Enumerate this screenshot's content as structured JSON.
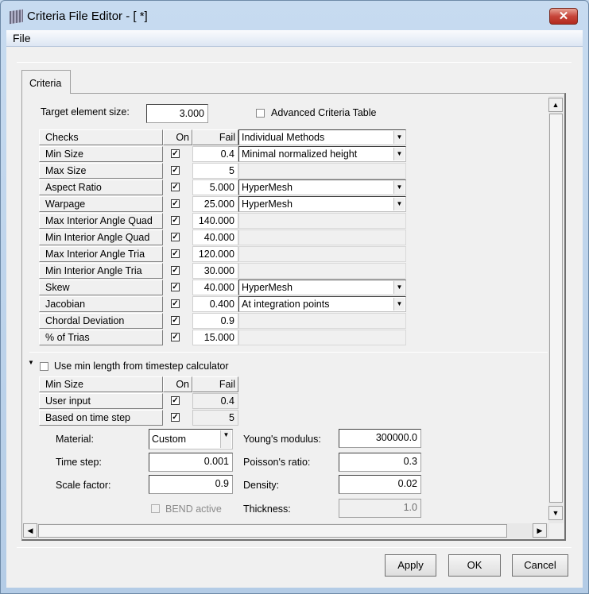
{
  "window": {
    "title": "Criteria File Editor - [ *]",
    "close_icon": "close-icon",
    "app_icon": "mesh-icon"
  },
  "menu": {
    "file": "File"
  },
  "tabs": [
    {
      "label": "Criteria",
      "active": true
    }
  ],
  "target": {
    "label": "Target element size:",
    "value": "3.000"
  },
  "advanced": {
    "label": "Advanced Criteria Table",
    "checked": false
  },
  "checks_table": {
    "headers": {
      "checks": "Checks",
      "on": "On",
      "fail": "Fail",
      "method": "Individual Methods"
    },
    "rows": [
      {
        "name": "Min Size",
        "on": true,
        "fail": "0.4",
        "method": "Minimal normalized height"
      },
      {
        "name": "Max Size",
        "on": true,
        "fail": "5",
        "method": ""
      },
      {
        "name": "Aspect Ratio",
        "on": true,
        "fail": "5.000",
        "method": "HyperMesh"
      },
      {
        "name": "Warpage",
        "on": true,
        "fail": "25.000",
        "method": "HyperMesh"
      },
      {
        "name": "Max Interior Angle Quad",
        "on": true,
        "fail": "140.000",
        "method": ""
      },
      {
        "name": "Min Interior Angle Quad",
        "on": true,
        "fail": "40.000",
        "method": ""
      },
      {
        "name": "Max Interior Angle Tria",
        "on": true,
        "fail": "120.000",
        "method": ""
      },
      {
        "name": "Min Interior Angle Tria",
        "on": true,
        "fail": "30.000",
        "method": ""
      },
      {
        "name": "Skew",
        "on": true,
        "fail": "40.000",
        "method": "HyperMesh"
      },
      {
        "name": "Jacobian",
        "on": true,
        "fail": "0.400",
        "method": "At integration points"
      },
      {
        "name": "Chordal Deviation",
        "on": true,
        "fail": "0.9",
        "method": ""
      },
      {
        "name": "% of Trias",
        "on": true,
        "fail": "15.000",
        "method": ""
      }
    ]
  },
  "timestep": {
    "use_label": "Use min length from timestep calculator",
    "use_checked": false,
    "headers": {
      "name": "Min Size",
      "on": "On",
      "fail": "Fail"
    },
    "rows": [
      {
        "name": "User input",
        "on": true,
        "fail": "0.4"
      },
      {
        "name": "Based on time step",
        "on": true,
        "fail": "5"
      }
    ],
    "material": {
      "label": "Material:",
      "value": "Custom"
    },
    "time_step": {
      "label": "Time step:",
      "value": "0.001"
    },
    "scale_factor": {
      "label": "Scale factor:",
      "value": "0.9"
    },
    "bend": {
      "label": "BEND active",
      "checked": false
    },
    "youngs": {
      "label": "Young's modulus:",
      "value": "300000.0"
    },
    "poisson": {
      "label": "Poisson's ratio:",
      "value": "0.3"
    },
    "density": {
      "label": "Density:",
      "value": "0.02"
    },
    "thickness": {
      "label": "Thickness:",
      "value": "1.0"
    }
  },
  "buttons": {
    "apply": "Apply",
    "ok": "OK",
    "cancel": "Cancel"
  }
}
